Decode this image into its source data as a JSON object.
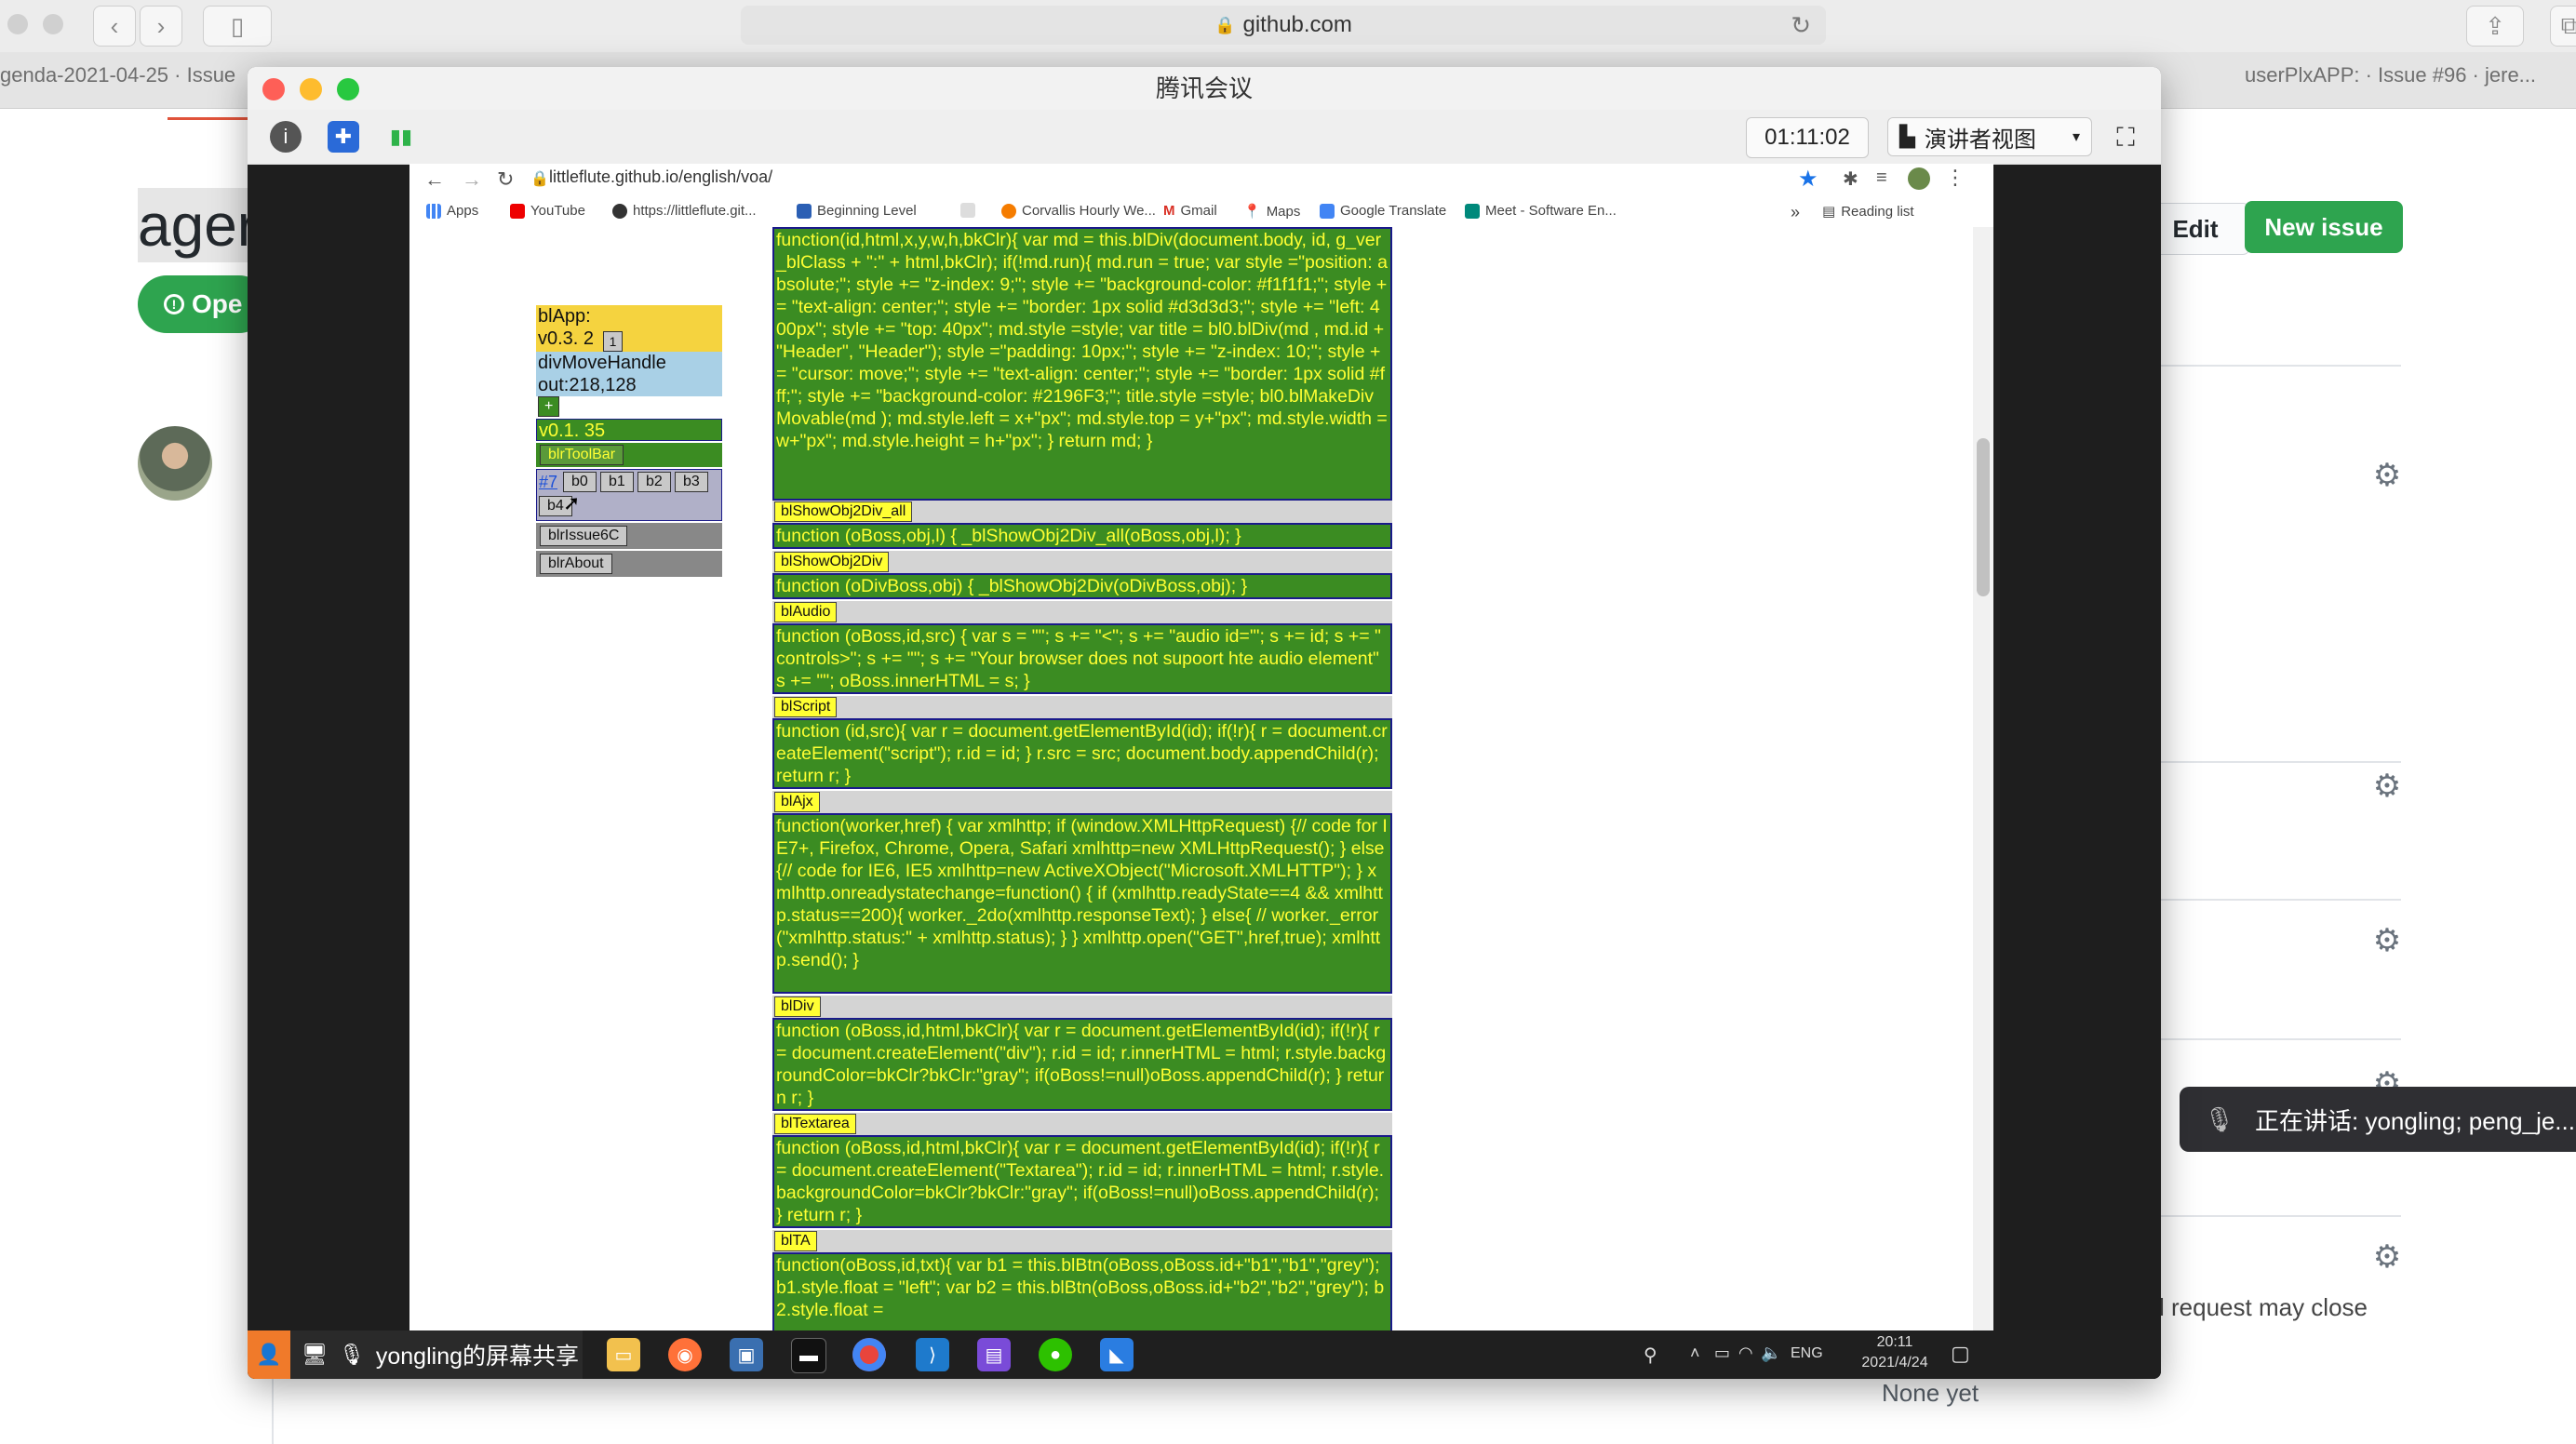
{
  "safari": {
    "url": "github.com",
    "tabs": [
      "genda-2021-04-25 · Issue",
      "userPlxAPP: · Issue #96 · jere..."
    ]
  },
  "github": {
    "title_fragment": "ager",
    "open_label": "Ope",
    "edit_label": "Edit",
    "new_issue_label": "New issue",
    "note_text": "l request may close",
    "none_yet": "None yet"
  },
  "speaking": {
    "text": "正在讲话: yongling; peng_je..."
  },
  "meeting": {
    "title": "腾讯会议",
    "timer": "01:11:02",
    "view_label": "演讲者视图",
    "share_label": "yongling的屏幕共享"
  },
  "remote_browser": {
    "url": "littleflute.github.io/english/voa/",
    "bookmarks": [
      "Apps",
      "YouTube",
      "https://littleflute.git...",
      "Beginning Level",
      "Corvallis Hourly We...",
      "Gmail",
      "Maps",
      "Google Translate",
      "Meet - Software En..."
    ],
    "reading_list": "Reading list",
    "overflow": "»"
  },
  "panel": {
    "app_line": "blApp:",
    "version_line": "v0.3. 2",
    "version_btn": "1",
    "move_handle": "divMoveHandle",
    "out_line": "out:218,128",
    "plus_btn": "+",
    "v_sub": "v0.1. 35",
    "toolbar_btn": "blrToolBar",
    "issue_link": "#7",
    "b_buttons": [
      "b0",
      "b1",
      "b2",
      "b3"
    ],
    "b4_btn": "b4",
    "issue6c_btn": "blrIssue6C",
    "about_btn": "blrAbout"
  },
  "code": {
    "top_block": "function(id,html,x,y,w,h,bkClr){ var md = this.blDiv(document.body, id, g_ver_blClass + \":\" + html,bkClr); if(!md.run){ md.run = true; var style =\"position: absolute;\"; style += \"z-index: 9;\"; style += \"background-color: #f1f1f1;\"; style += \"text-align: center;\"; style += \"border: 1px solid #d3d3d3;\"; style += \"left: 400px\"; style += \"top: 40px\"; md.style =style; var title = bl0.blDiv(md , md.id + \"Header\", \"Header\"); style =\"padding: 10px;\"; style += \"z-index: 10;\"; style += \"cursor: move;\"; style += \"text-align: center;\"; style += \"border: 1px solid #fff;\"; style += \"background-color: #2196F3;\"; title.style =style; bl0.blMakeDivMovable(md ); md.style.left = x+\"px\"; md.style.top = y+\"px\"; md.style.width = w+\"px\"; md.style.height = h+\"px\"; } return md; }",
    "sections": [
      {
        "label": "blShowObj2Div_all",
        "body": "function (oBoss,obj,l) { _blShowObj2Div_all(oBoss,obj,l); }"
      },
      {
        "label": "blShowObj2Div",
        "body": "function (oDivBoss,obj) { _blShowObj2Div(oDivBoss,obj); }"
      },
      {
        "label": "blAudio",
        "body": "function (oBoss,id,src) { var s = \"\"; s += \"<\"; s += \"audio id='\"; s += id; s += \" controls>\"; s += \"\"; s += \"Your browser does not supoort hte audio element\" s += \"\"; oBoss.innerHTML = s; }"
      },
      {
        "label": "blScript",
        "body": "function (id,src){ var r = document.getElementById(id); if(!r){ r = document.createElement(\"script\"); r.id = id; } r.src = src; document.body.appendChild(r); return r; }"
      },
      {
        "label": "blAjx",
        "body": "function(worker,href) { var xmlhttp; if (window.XMLHttpRequest) {// code for IE7+, Firefox, Chrome, Opera, Safari xmlhttp=new XMLHttpRequest(); } else {// code for IE6, IE5 xmlhttp=new ActiveXObject(\"Microsoft.XMLHTTP\"); } xmlhttp.onreadystatechange=function() { if (xmlhttp.readyState==4 && xmlhttp.status==200){ worker._2do(xmlhttp.responseText); } else{ // worker._error(\"xmlhttp.status:\" + xmlhttp.status); } } xmlhttp.open(\"GET\",href,true); xmlhttp.send(); }"
      },
      {
        "label": "blDiv",
        "body": "function (oBoss,id,html,bkClr){ var r = document.getElementById(id); if(!r){ r = document.createElement(\"div\"); r.id = id; r.innerHTML = html; r.style.backgroundColor=bkClr?bkClr:\"gray\"; if(oBoss!=null)oBoss.appendChild(r); } return r; }"
      },
      {
        "label": "blTextarea",
        "body": "function (oBoss,id,html,bkClr){ var r = document.getElementById(id); if(!r){ r = document.createElement(\"Textarea\"); r.id = id; r.innerHTML = html; r.style.backgroundColor=bkClr?bkClr:\"gray\"; if(oBoss!=null)oBoss.appendChild(r); } return r; }"
      },
      {
        "label": "blTA",
        "body": "function(oBoss,id,txt){ var b1 = this.blBtn(oBoss,oBoss.id+\"b1\",\"b1\",\"grey\"); b1.style.float = \"left\"; var b2 = this.blBtn(oBoss,oBoss.id+\"b2\",\"b2\",\"grey\"); b2.style.float ="
      }
    ]
  },
  "tray": {
    "lang": "ENG",
    "time": "20:11",
    "date": "2021/4/24"
  }
}
